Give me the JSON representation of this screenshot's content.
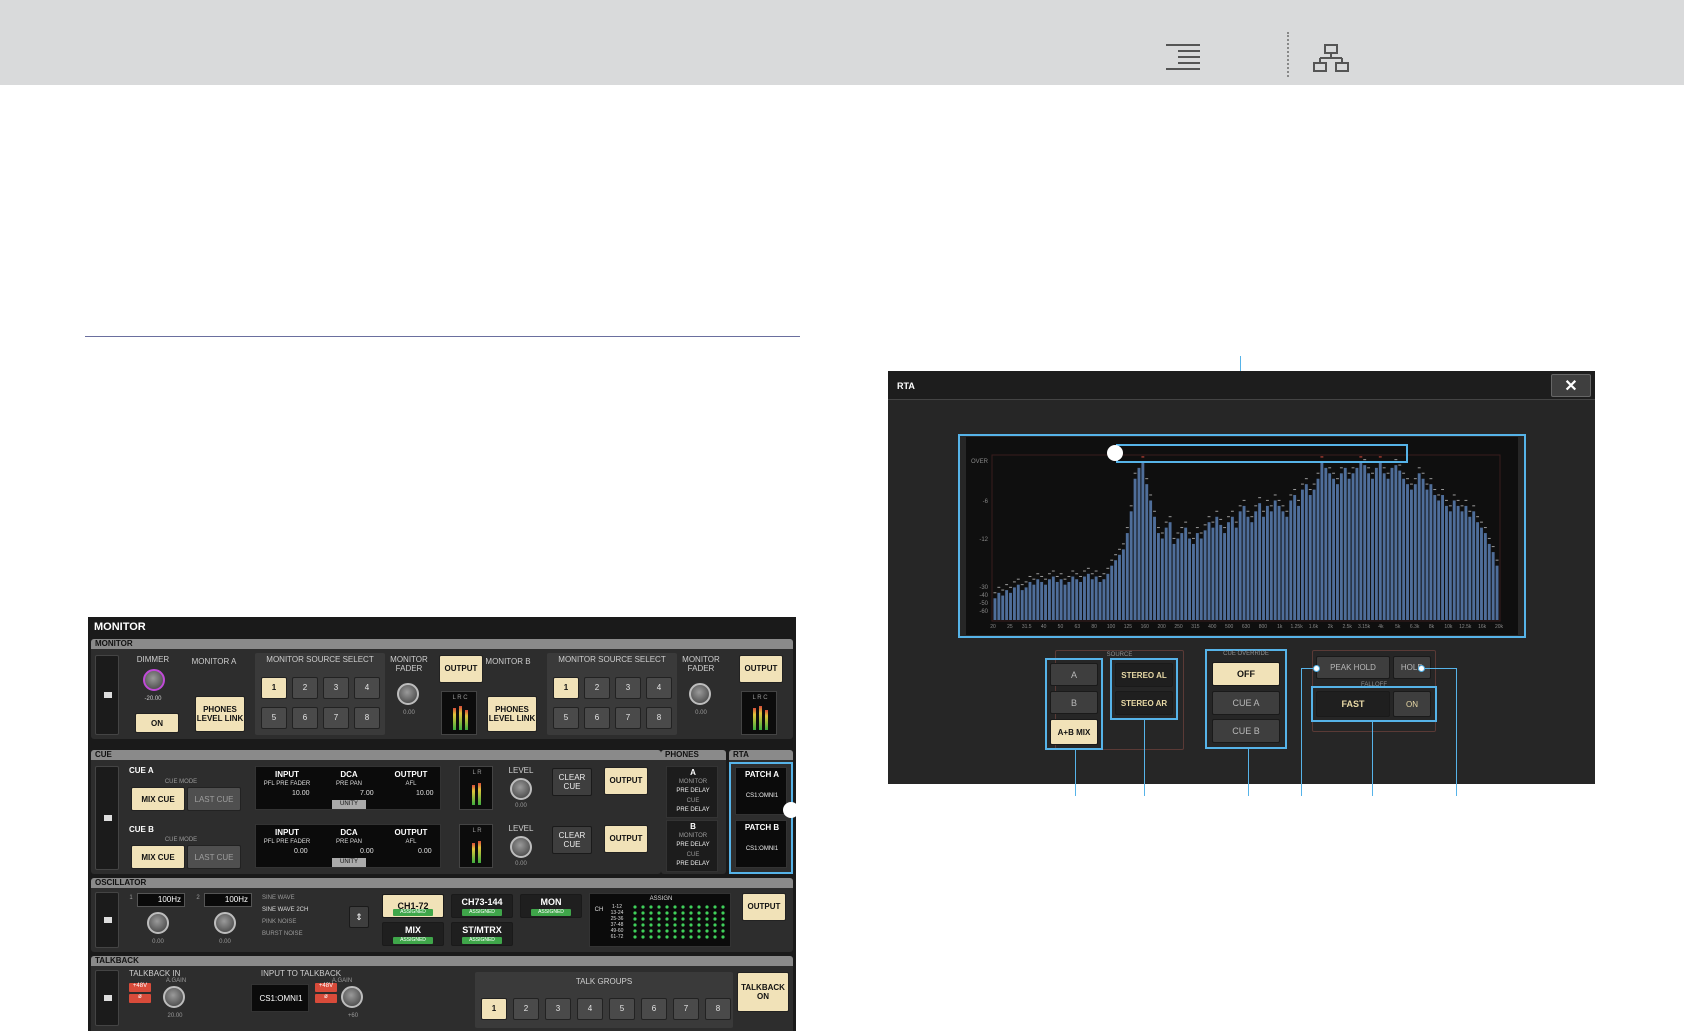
{
  "topbar": {
    "toc_icon": "toc-icon",
    "sitemap_icon": "sitemap-icon"
  },
  "monitor": {
    "title": "MONITOR",
    "sections": {
      "monitor": "MONITOR",
      "cue": "CUE",
      "phones": "PHONES",
      "rta": "RTA",
      "oscillator": "OSCILLATOR",
      "talkback": "TALKBACK"
    },
    "dimmer": {
      "label": "DIMMER",
      "value": "-20.00",
      "on": "ON"
    },
    "monitor_a": {
      "label": "MONITOR A",
      "phones_link": "PHONES LEVEL LINK",
      "source_select": "MONITOR SOURCE SELECT",
      "fader": "MONITOR FADER",
      "fader_value": "0.00",
      "output": "OUTPUT",
      "meter_labels": "L R C"
    },
    "monitor_b": {
      "label": "MONITOR B",
      "phones_link": "PHONES LEVEL LINK",
      "source_select": "MONITOR SOURCE SELECT",
      "fader": "MONITOR FADER",
      "fader_value": "0.00",
      "output": "OUTPUT",
      "meter_labels": "L R C"
    },
    "source_buttons": [
      "1",
      "2",
      "3",
      "4",
      "5",
      "6",
      "7",
      "8"
    ],
    "cue_a": {
      "label": "CUE A",
      "mode": "CUE MODE",
      "mix_cue": "MIX CUE",
      "last_cue": "LAST CUE",
      "input": "INPUT",
      "input_sub": "PFL PRE FADER",
      "input_val": "10.00",
      "dca": "DCA",
      "dca_sub": "PRE PAN",
      "dca_val": "7.00",
      "unity": "UNITY",
      "output": "OUTPUT",
      "output_sub": "AFL",
      "output_val": "10.00",
      "meter_labels": "L R",
      "level": "LEVEL",
      "level_val": "0.00",
      "clear_cue": "CLEAR CUE",
      "output_btn": "OUTPUT"
    },
    "cue_b": {
      "label": "CUE B",
      "mode": "CUE MODE",
      "mix_cue": "MIX CUE",
      "last_cue": "LAST CUE",
      "input": "INPUT",
      "input_sub": "PFL PRE FADER",
      "input_val": "0.00",
      "dca": "DCA",
      "dca_sub": "PRE PAN",
      "dca_val": "0.00",
      "unity": "UNITY",
      "output": "OUTPUT",
      "output_sub": "AFL",
      "output_val": "0.00",
      "meter_labels": "L R",
      "level": "LEVEL",
      "level_val": "0.00",
      "clear_cue": "CLEAR CUE",
      "output_btn": "OUTPUT"
    },
    "phones": {
      "a": "A",
      "a_lines": [
        "MONITOR",
        "PRE DELAY",
        "CUE",
        "PRE DELAY"
      ],
      "b": "B",
      "b_lines": [
        "MONITOR",
        "PRE DELAY",
        "CUE",
        "PRE DELAY"
      ]
    },
    "rta_patch": {
      "patch_a": "PATCH A",
      "patch_a_val": "CS1:OMNI1",
      "patch_b": "PATCH B",
      "patch_b_val": "CS1:OMNI1"
    },
    "oscillator": {
      "ch1": "1",
      "ch1_freq": "100Hz",
      "ch2": "2",
      "ch2_freq": "100Hz",
      "knob1": "0.00",
      "knob2": "0.00",
      "modes": [
        "SINE WAVE",
        "SINE WAVE 2CH",
        "PINK NOISE",
        "BURST NOISE"
      ],
      "dest": [
        {
          "name": "CH1-72",
          "status": "ASSIGNED"
        },
        {
          "name": "CH73-144",
          "status": "ASSIGNED"
        },
        {
          "name": "MON",
          "status": "ASSIGNED"
        },
        {
          "name": "MIX",
          "status": "ASSIGNED"
        },
        {
          "name": "ST/MTRX",
          "status": "ASSIGNED"
        }
      ],
      "assign": "ASSIGN",
      "ch_label": "CH",
      "ranges": [
        "1-12",
        "13-24",
        "25-36",
        "37-48",
        "49-60",
        "61-72"
      ],
      "output": "OUTPUT"
    },
    "talkback": {
      "in": "TALKBACK IN",
      "again": "A.GAIN",
      "phantom": "+48V",
      "phase": "ø",
      "in_val": "20.00",
      "input_to": "INPUT TO TALKBACK",
      "input_to_val": "CS1:OMNI1",
      "again2": "A.GAIN",
      "phantom2": "+48V",
      "phase2": "ø",
      "val2": "+60",
      "groups_label": "TALK GROUPS",
      "groups": [
        "1",
        "2",
        "3",
        "4",
        "5",
        "6",
        "7",
        "8"
      ],
      "on": "TALKBACK ON"
    }
  },
  "rta": {
    "title": "RTA",
    "close": "✕",
    "y_labels": [
      "OVER",
      "-6",
      "-12",
      "-30",
      "-40",
      "-50",
      "-60"
    ],
    "x_labels": [
      "20",
      "25",
      "31.5",
      "40",
      "50",
      "63",
      "80",
      "100",
      "125",
      "160",
      "200",
      "250",
      "315",
      "400",
      "500",
      "630",
      "800",
      "1k",
      "1.25k",
      "1.6k",
      "2k",
      "2.5k",
      "3.15k",
      "4k",
      "5k",
      "6.3k",
      "8k",
      "10k",
      "12.5k",
      "16k",
      "20k"
    ],
    "source": {
      "title": "SOURCE",
      "a": "A",
      "b": "B",
      "mix": "A+B MIX",
      "stereo_al": "STEREO AL",
      "stereo_ar": "STEREO AR"
    },
    "cue_override": {
      "title": "CUE OVERRIDE",
      "off": "OFF",
      "cue_a": "CUE A",
      "cue_b": "CUE B"
    },
    "peak_hold": "PEAK HOLD",
    "hold": "HOLD",
    "falloff_title": "FALLOFF",
    "falloff_value": "FAST",
    "falloff_on": "ON"
  },
  "chart_data": {
    "type": "bar",
    "ylim": [
      -60,
      0
    ],
    "values": [
      -52,
      -50,
      -51,
      -49,
      -50,
      -48,
      -47,
      -49,
      -48,
      -46,
      -47,
      -45,
      -46,
      -47,
      -45,
      -44,
      -46,
      -45,
      -47,
      -46,
      -44,
      -45,
      -46,
      -44,
      -43,
      -45,
      -44,
      -46,
      -45,
      -43,
      -40,
      -38,
      -36,
      -34,
      -28,
      -20,
      -8,
      -4,
      -2,
      -10,
      -16,
      -22,
      -28,
      -30,
      -26,
      -24,
      -32,
      -30,
      -28,
      -26,
      -30,
      -32,
      -28,
      -30,
      -27,
      -24,
      -26,
      -22,
      -25,
      -28,
      -24,
      -22,
      -26,
      -20,
      -18,
      -22,
      -24,
      -20,
      -17,
      -22,
      -18,
      -20,
      -16,
      -18,
      -20,
      -22,
      -16,
      -14,
      -18,
      -12,
      -10,
      -14,
      -12,
      -8,
      -2,
      -4,
      -6,
      -8,
      -10,
      -6,
      -4,
      -8,
      -6,
      -4,
      -2,
      -3,
      -6,
      -8,
      -4,
      -2,
      -6,
      -8,
      -4,
      -3,
      -5,
      -8,
      -10,
      -12,
      -10,
      -6,
      -8,
      -12,
      -10,
      -14,
      -16,
      -14,
      -18,
      -20,
      -16,
      -18,
      -20,
      -18,
      -22,
      -20,
      -24,
      -26,
      -28,
      -32,
      -35,
      -40
    ]
  }
}
